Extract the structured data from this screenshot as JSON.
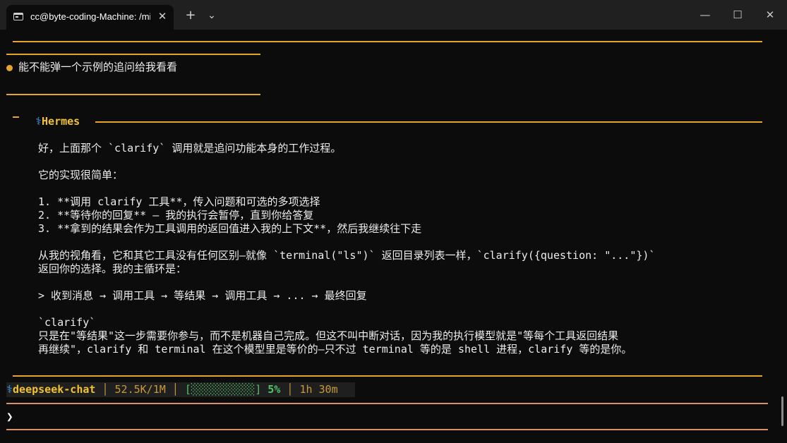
{
  "window": {
    "tab_title": "cc@byte-coding-Machine: /mi",
    "tab_close": "✕",
    "new_tab": "+",
    "dropdown": "⌄",
    "minimize": "—",
    "maximize": "☐",
    "close": "✕"
  },
  "chat": {
    "user_message": "能不能弹一个示例的追问给我看看",
    "assistant_name": "Hermes",
    "assistant_icon": "⚕",
    "lines": [
      "好，上面那个 `clarify` 调用就是追问功能本身的工作过程。",
      "它的实现很简单：",
      "1. **调用 clarify 工具**，传入问题和可选的多项选择",
      "2. **等待你的回复** — 我的执行会暂停，直到你给答复",
      "3. **拿到的结果会作为工具调用的返回值进入我的上下文**，然后我继续往下走",
      "从我的视角看，它和其它工具没有任何区别—就像 `terminal(\"ls\")` 返回目录列表一样，`clarify({question: \"...\"})`",
      "返回你的选择。我的主循环是：",
      "> 收到消息 → 调用工具 → 等结果 → 调用工具 → ... → 最终回复",
      "`clarify`",
      "只是在\"等结果\"这一步需要你参与，而不是机器自己完成。但这不叫中断对话，因为我的执行模型就是\"等每个工具返回结果",
      "再继续\"，clarify 和 terminal 在这个模型里是等价的—只不过 terminal 等的是 shell 进程，clarify 等的是你。"
    ]
  },
  "status": {
    "icon": "⚕",
    "model": "deepseek-chat",
    "sep": "│",
    "tokens": "52.5K/1M",
    "bar": "[░░░░░░░░░░]",
    "percent": "5%",
    "duration": "1h 30m"
  },
  "prompt": {
    "symbol": "❯"
  }
}
